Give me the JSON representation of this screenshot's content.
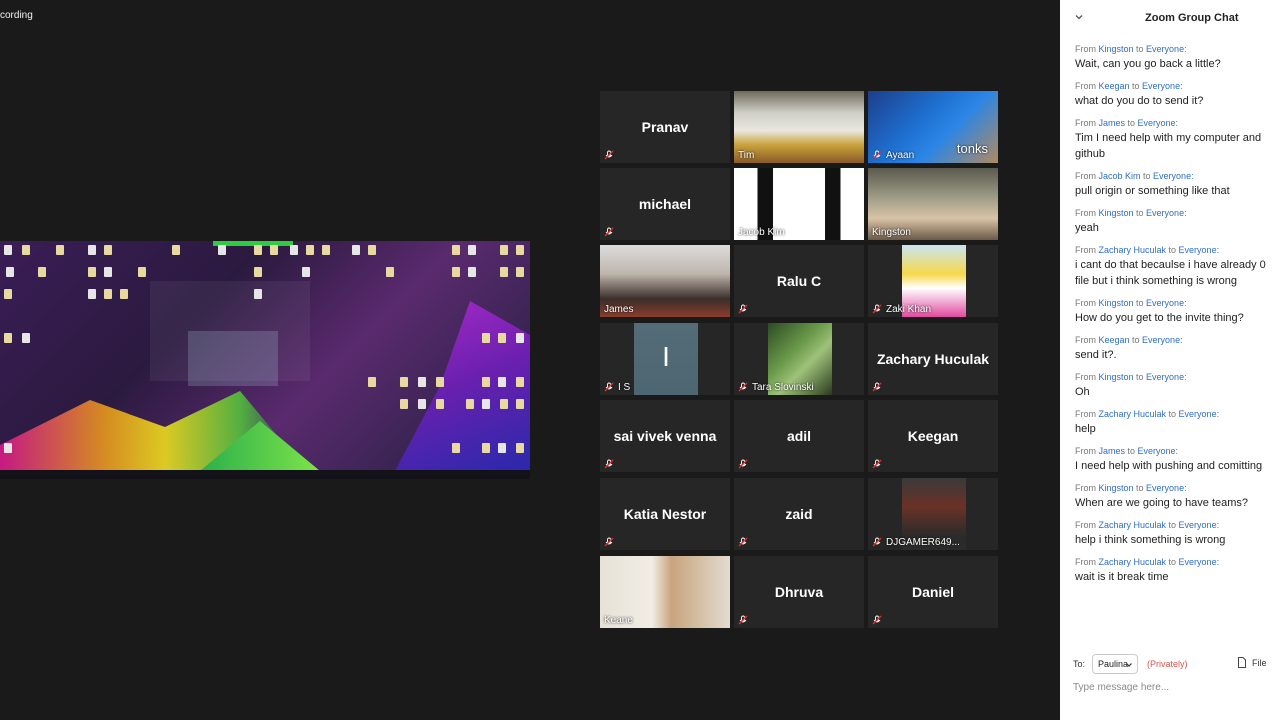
{
  "recording_label": "cording",
  "chat": {
    "title": "Zoom Group Chat",
    "messages": [
      {
        "from": "Kingston",
        "to": "Everyone:",
        "text": "Wait, can you go back a little?"
      },
      {
        "from": "Keegan",
        "to": "Everyone:",
        "text": "what do you do to send it?"
      },
      {
        "from": "James",
        "to": "Everyone:",
        "text": "Tim I need help with my computer and github"
      },
      {
        "from": "Jacob Kim",
        "to": "Everyone:",
        "text": "pull origin or something like that"
      },
      {
        "from": "Kingston",
        "to": "Everyone:",
        "text": "yeah"
      },
      {
        "from": "Zachary Huculak",
        "to": "Everyone:",
        "text": "i cant do that becaulse i have already 0 file but i think something is wrong"
      },
      {
        "from": "Kingston",
        "to": "Everyone:",
        "text": "How do you get to the invite thing?"
      },
      {
        "from": "Keegan",
        "to": "Everyone:",
        "text": "send it?."
      },
      {
        "from": "Kingston",
        "to": "Everyone:",
        "text": "Oh"
      },
      {
        "from": "Zachary Huculak",
        "to": "Everyone:",
        "text": "help"
      },
      {
        "from": "James",
        "to": "Everyone:",
        "text": "I need help with pushing and comitting"
      },
      {
        "from": "Kingston",
        "to": "Everyone:",
        "text": "When are we going to have teams?"
      },
      {
        "from": "Zachary Huculak",
        "to": "Everyone:",
        "text": "help i think something is wrong"
      },
      {
        "from": "Zachary Huculak",
        "to": "Everyone:",
        "text": "wait is it break time"
      }
    ],
    "from_word": "From",
    "to_word": "to",
    "to_label": "To:",
    "recipient": "Paulina",
    "privately": "(Privately)",
    "file_label": "File",
    "input_placeholder": "Type message here..."
  },
  "participants": [
    {
      "name": "Pranav",
      "video": false
    },
    {
      "name": "Tim",
      "video": true
    },
    {
      "name": "Ayaan",
      "video": true,
      "overlay": "tonks"
    },
    {
      "name": "michael",
      "video": false
    },
    {
      "name": "Jacob Kim",
      "video": true
    },
    {
      "name": "Kingston",
      "video": true
    },
    {
      "name": "James",
      "video": true,
      "active_speaker": true
    },
    {
      "name": "Ralu C",
      "video": false
    },
    {
      "name": "Zaki Khan",
      "video": true
    },
    {
      "name": "I S",
      "video": true,
      "avatar_letter": "I"
    },
    {
      "name": "Tara Slovinski",
      "video": true
    },
    {
      "name": "Zachary Huculak",
      "video": false
    },
    {
      "name": "sai vivek venna",
      "video": false
    },
    {
      "name": "adil",
      "video": false
    },
    {
      "name": "Keegan",
      "video": false
    },
    {
      "name": "Katia Nestor",
      "video": false
    },
    {
      "name": "zaid",
      "video": false
    },
    {
      "name": "DJGAMER649...",
      "video": true
    },
    {
      "name": "Keane",
      "video": true
    },
    {
      "name": "Dhruva",
      "video": false
    },
    {
      "name": "Daniel",
      "video": false
    }
  ],
  "icons": {
    "muted": "muted-mic-icon",
    "collapse": "chevron-down-icon",
    "file": "file-icon"
  },
  "colors": {
    "muted_red": "#d9302c",
    "active_outline": "#c8e05a",
    "chat_link": "#2d6ec7",
    "privately": "#d9534f"
  }
}
